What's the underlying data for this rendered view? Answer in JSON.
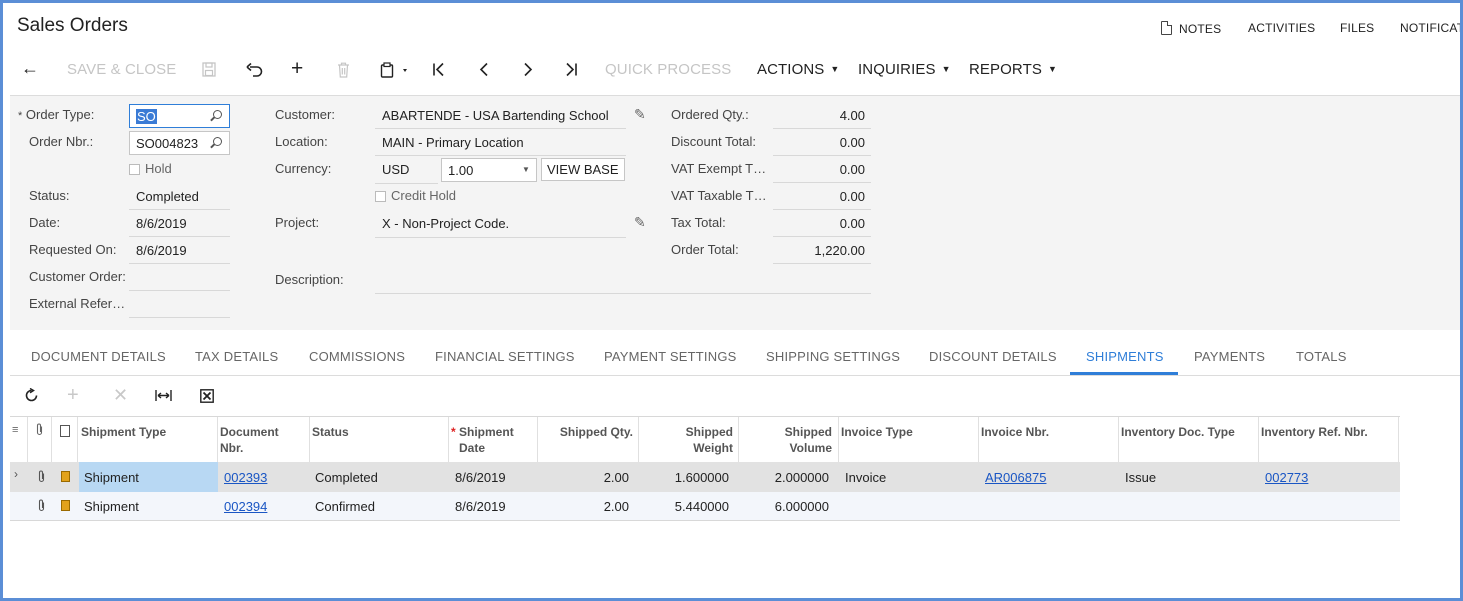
{
  "header": {
    "title": "Sales Orders",
    "links": [
      "NOTES",
      "ACTIVITIES",
      "FILES",
      "NOTIFICAT"
    ]
  },
  "toolbar": {
    "save_close": "SAVE & CLOSE",
    "quick_process": "QUICK PROCESS",
    "actions": "ACTIONS",
    "inquiries": "INQUIRIES",
    "reports": "REPORTS"
  },
  "summary": {
    "order_type_label": "Order Type:",
    "order_type_value": "SO",
    "order_nbr_label": "Order Nbr.:",
    "order_nbr_value": "SO004823",
    "hold_label": "Hold",
    "status_label": "Status:",
    "status_value": "Completed",
    "date_label": "Date:",
    "date_value": "8/6/2019",
    "requested_on_label": "Requested On:",
    "requested_on_value": "8/6/2019",
    "customer_order_label": "Customer Order:",
    "external_ref_label": "External Refer…",
    "customer_label": "Customer:",
    "customer_value": "ABARTENDE - USA Bartending School",
    "location_label": "Location:",
    "location_value": "MAIN - Primary Location",
    "currency_label": "Currency:",
    "currency_value": "USD",
    "currency_rate": "1.00",
    "view_base": "VIEW BASE",
    "credit_hold_label": "Credit Hold",
    "project_label": "Project:",
    "project_value": "X - Non-Project Code.",
    "description_label": "Description:",
    "ordered_qty_label": "Ordered Qty.:",
    "ordered_qty_value": "4.00",
    "discount_total_label": "Discount Total:",
    "discount_total_value": "0.00",
    "vat_exempt_label": "VAT Exempt T…",
    "vat_exempt_value": "0.00",
    "vat_taxable_label": "VAT Taxable T…",
    "vat_taxable_value": "0.00",
    "tax_total_label": "Tax Total:",
    "tax_total_value": "0.00",
    "order_total_label": "Order Total:",
    "order_total_value": "1,220.00"
  },
  "tabs": [
    "DOCUMENT DETAILS",
    "TAX DETAILS",
    "COMMISSIONS",
    "FINANCIAL SETTINGS",
    "PAYMENT SETTINGS",
    "SHIPPING SETTINGS",
    "DISCOUNT DETAILS",
    "SHIPMENTS",
    "PAYMENTS",
    "TOTALS"
  ],
  "active_tab": "SHIPMENTS",
  "grid": {
    "columns": {
      "shipment_type": "Shipment Type",
      "document_nbr_1": "Document",
      "document_nbr_2": "Nbr.",
      "status": "Status",
      "shipment_date_1": "Shipment",
      "shipment_date_2": "Date",
      "shipped_qty": "Shipped Qty.",
      "shipped_weight_1": "Shipped",
      "shipped_weight_2": "Weight",
      "shipped_volume_1": "Shipped",
      "shipped_volume_2": "Volume",
      "invoice_type": "Invoice Type",
      "invoice_nbr": "Invoice Nbr.",
      "inventory_doc_type": "Inventory Doc. Type",
      "inventory_ref_nbr": "Inventory Ref. Nbr."
    },
    "rows": [
      {
        "shipment_type": "Shipment",
        "document_nbr": "002393",
        "status": "Completed",
        "shipment_date": "8/6/2019",
        "shipped_qty": "2.00",
        "shipped_weight": "1.600000",
        "shipped_volume": "2.000000",
        "invoice_type": "Invoice",
        "invoice_nbr": "AR006875",
        "inventory_doc_type": "Issue",
        "inventory_ref_nbr": "002773"
      },
      {
        "shipment_type": "Shipment",
        "document_nbr": "002394",
        "status": "Confirmed",
        "shipment_date": "8/6/2019",
        "shipped_qty": "2.00",
        "shipped_weight": "5.440000",
        "shipped_volume": "6.000000",
        "invoice_type": "",
        "invoice_nbr": "",
        "inventory_doc_type": "",
        "inventory_ref_nbr": ""
      }
    ]
  },
  "colors": {
    "accent": "#2f7ed8",
    "frame": "#5b8ed6",
    "link": "#1a56c4",
    "selected_cell": "#b8d8f3"
  }
}
